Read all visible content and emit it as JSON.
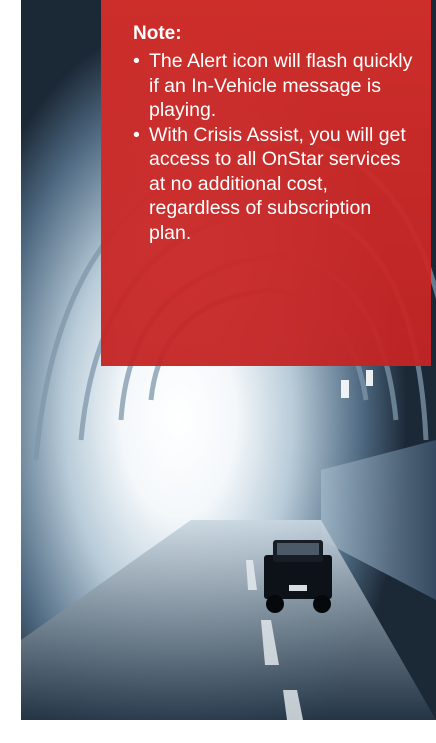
{
  "note": {
    "title": "Note:",
    "bullet_glyph": "•",
    "items": [
      "The Alert icon will flash quickly if an In-Vehicle message is playing.",
      "With Crisis Assist, you will get access to all OnStar services at no additional cost, regardless of subscription plan."
    ]
  },
  "colors": {
    "note_background": "#d42e2a",
    "note_text": "#ffffff"
  }
}
